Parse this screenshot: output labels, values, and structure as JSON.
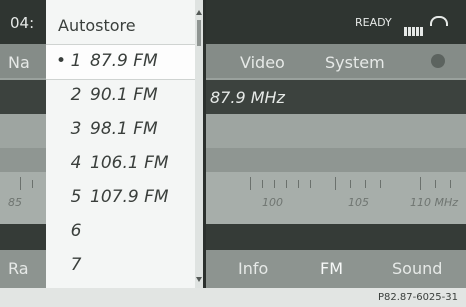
{
  "header": {
    "time": "04:",
    "status": "READY",
    "signal_icon": "signal-bars-icon",
    "phone_icon": "phone-hangup-icon"
  },
  "nav": {
    "left_label": "Na",
    "tabs": [
      "Video",
      "System"
    ],
    "indicator_icon": "circle-icon"
  },
  "frequency": {
    "current": "87.9 MHz"
  },
  "scale": {
    "labels": [
      "85",
      "100",
      "105",
      "110 MHz"
    ]
  },
  "bottom_nav": {
    "left_label": "Ra",
    "items": [
      "Info",
      "FM",
      "Sound"
    ],
    "active": "FM"
  },
  "autostore": {
    "title": "Autostore",
    "items": [
      {
        "num": "1",
        "freq": "87.9 FM",
        "selected": true
      },
      {
        "num": "2",
        "freq": "90.1 FM"
      },
      {
        "num": "3",
        "freq": "98.1 FM"
      },
      {
        "num": "4",
        "freq": "106.1 FM"
      },
      {
        "num": "5",
        "freq": "107.9 FM"
      },
      {
        "num": "6",
        "freq": ""
      },
      {
        "num": "7",
        "freq": ""
      }
    ]
  },
  "figure_code": "P82.87-6025-31",
  "colors": {
    "overlay_bg": "#f4f6f5",
    "dark_bar": "#2f3531",
    "text_light": "#e6e9e7"
  }
}
